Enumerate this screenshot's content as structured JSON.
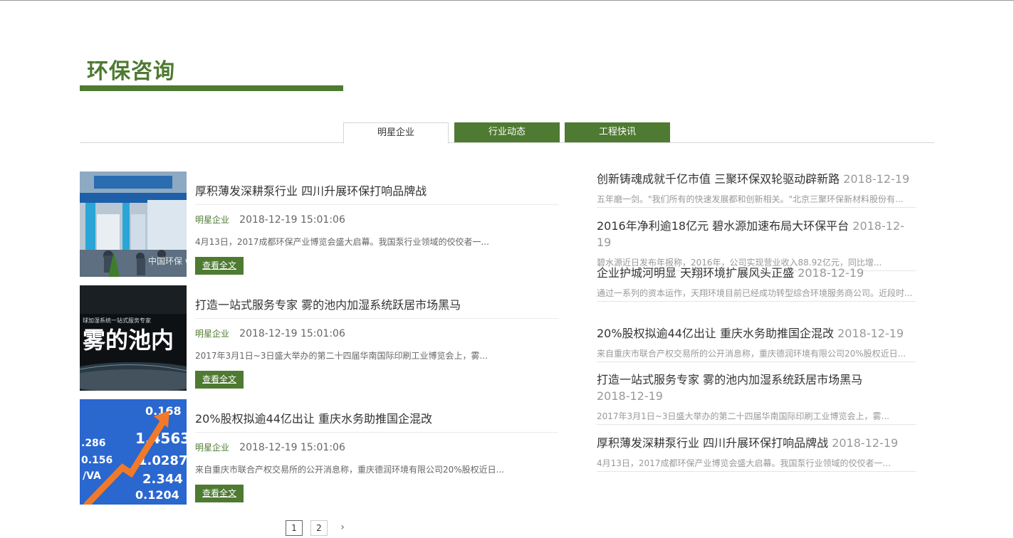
{
  "section": {
    "title": "环保咨询"
  },
  "tabs": [
    {
      "label": "明星企业",
      "active": true
    },
    {
      "label": "行业动态",
      "active": false
    },
    {
      "label": "工程快讯",
      "active": false
    }
  ],
  "cards": [
    {
      "title": "厚积薄发深耕泵行业 四川升展环保打响品牌战",
      "category": "明星企业",
      "datetime": "2018-12-19 15:01:06",
      "summary": "4月13日，2017成都环保产业博览会盛大启幕。我国泵行业领域的佼佼者一...",
      "button": "查看全文",
      "image_text": "中国环保 www.hbzhan"
    },
    {
      "title": "打造一站式服务专家 雾的池内加湿系统跃居市场黑马",
      "category": "明星企业",
      "datetime": "2018-12-19 15:01:06",
      "summary": "2017年3月1日~3日盛大举办的第二十四届华南国际印刷工业博览会上，雾...",
      "button": "查看全文",
      "image_text": "雾的池内",
      "image_subtext": "球加湿系统一站式服务专家"
    },
    {
      "title": "20%股权拟逾44亿出让 重庆水务助推国企混改",
      "category": "明星企业",
      "datetime": "2018-12-19 15:01:06",
      "summary": "来自重庆市联合产权交易所的公开消息称，重庆德润环境有限公司20%股权近日...",
      "button": "查看全文",
      "image_numbers": [
        "0.168",
        "1.4563",
        "1.0287",
        "2.344",
        "0.1204",
        ".286",
        "0.156",
        "/VA"
      ]
    }
  ],
  "news": [
    {
      "title": "创新铸魂成就千亿市值 三聚环保双轮驱动辟新路",
      "date": "2018-12-19",
      "summary": "五年磨一剑。\"我们所有的快速发展都和创新相关。\"北京三聚环保新材料股份有..."
    },
    {
      "title": "2016年净利逾18亿元 碧水源加速布局大环保平台",
      "date": "2018-12-19",
      "summary": "碧水源近日发布年报称，2016年，公司实现营业收入88.92亿元，同比增..."
    },
    {
      "title": "企业护城河明显 天翔环境扩展风头正盛",
      "date": "2018-12-19",
      "summary": "通过一系列的资本运作，天翔环境目前已经成功转型综合环境服务商公司。近段时..."
    },
    {
      "title": "20%股权拟逾44亿出让 重庆水务助推国企混改",
      "date": "2018-12-19",
      "summary": "来自重庆市联合产权交易所的公开消息称，重庆德润环境有限公司20%股权近日..."
    },
    {
      "title": "打造一站式服务专家 雾的池内加湿系统跃居市场黑马",
      "date": "2018-12-19",
      "summary": "2017年3月1日~3日盛大举办的第二十四届华南国际印刷工业博览会上，雾..."
    },
    {
      "title": "厚积薄发深耕泵行业 四川升展环保打响品牌战",
      "date": "2018-12-19",
      "summary": "4月13日，2017成都环保产业博览会盛大启幕。我国泵行业领域的佼佼者一..."
    }
  ],
  "pagination": {
    "pages": [
      "1",
      "2"
    ],
    "current": "1",
    "next_glyph": "›"
  },
  "colors": {
    "brand_green": "#4e7a31",
    "tab_text": "#333333",
    "muted": "#999999"
  }
}
